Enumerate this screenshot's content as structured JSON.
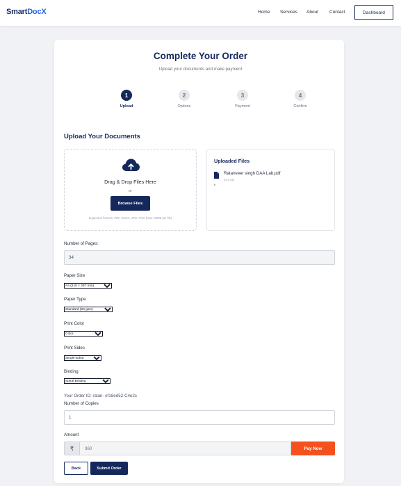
{
  "nav": {
    "logo_part1": "Smart",
    "logo_part2": "DocX",
    "links": [
      "Home",
      "Services",
      "About",
      "Contact"
    ],
    "dashboard_label": "Dashboard"
  },
  "page": {
    "title": "Complete Your Order",
    "subtitle": "Upload your documents and make payment"
  },
  "steps": [
    {
      "num": "1",
      "label": "Upload"
    },
    {
      "num": "2",
      "label": "Options"
    },
    {
      "num": "3",
      "label": "Payment"
    },
    {
      "num": "4",
      "label": "Confirm"
    }
  ],
  "upload": {
    "section_title": "Upload Your Documents",
    "dropzone_title": "Drag & Drop Files Here",
    "or_text": "or",
    "browse_label": "Browse Files",
    "formats_text": "Supported formats: PDF, DOCX, JPG, PNG (Max: 20MB per file)"
  },
  "uploaded": {
    "title": "Uploaded Files",
    "file_name": "Ratanveer singh DAA Lab.pdf",
    "file_size": "44.3 KB",
    "remove_label": "×"
  },
  "form": {
    "pages_label": "Number of Pages:",
    "pages_value": "34",
    "paper_size_label": "Paper Size",
    "paper_size_value": "A4 (210 × 297 mm)",
    "paper_type_label": "Paper Type",
    "paper_type_value": "Standard (80 gsm)",
    "print_color_label": "Print Color",
    "print_color_value": "Color",
    "print_sides_label": "Print Sides",
    "print_sides_value": "Single-sided",
    "binding_label": "Binding",
    "binding_value": "Spiral Binding",
    "order_id": "Your Order ID: ratan- ef18ed52-C4e2s",
    "copies_label": "Number of Copies",
    "copies_value": "1",
    "amount_label": "Amount",
    "currency_symbol": "₹",
    "amount_value": "360",
    "pay_label": "Pay Now",
    "back_label": "Back",
    "submit_label": "Submit Order"
  },
  "colors": {
    "brand_navy": "#15285c",
    "brand_blue": "#2563eb",
    "pay_orange": "#f4511e"
  }
}
